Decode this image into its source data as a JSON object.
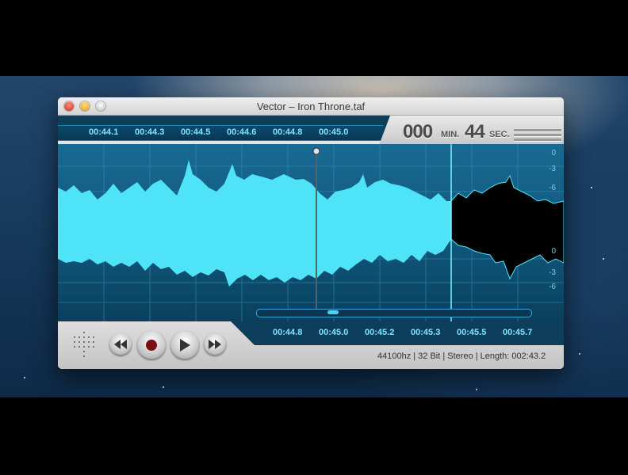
{
  "window": {
    "title": "Vector – Iron Throne.taf"
  },
  "timer": {
    "minutes": "000",
    "minutes_unit": "MIN.",
    "seconds": "44",
    "seconds_unit": "SEC."
  },
  "timeline_top": [
    "00:44.1",
    "00:44.3",
    "00:44.5",
    "00:44.6",
    "00:44.8",
    "00:45.0"
  ],
  "timeline_bottom": [
    "00:44.8",
    "00:45.0",
    "00:45.2",
    "00:45.3",
    "00:45.5",
    "00:45.7"
  ],
  "db_scale": [
    "0",
    "-3",
    "-6",
    "-6",
    "-3",
    "0"
  ],
  "controls": {
    "rewind": "rewind-icon",
    "record": "record-icon",
    "play": "play-icon",
    "forward": "fast-forward-icon"
  },
  "status": "44100hz | 32 Bit | Stereo | Length: 002:43.2",
  "colors": {
    "waveform": "#4fe3f7",
    "waveform_unplayed": "#000000",
    "background": "#0f5478",
    "accent": "#7fe3ff"
  }
}
